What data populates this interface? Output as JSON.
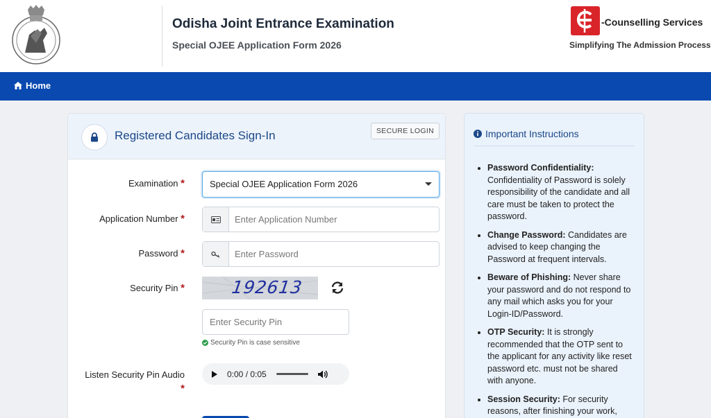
{
  "header": {
    "title": "Odisha Joint Entrance Examination",
    "subtitle": "Special OJEE Application Form 2026",
    "brand_name": "-Counselling Services",
    "brand_tagline": "Simplifying The Admission Process"
  },
  "nav": {
    "home_label": "Home"
  },
  "login": {
    "title": "Registered Candidates Sign-In",
    "secure_badge": "SECURE LOGIN",
    "examination_label": "Examination",
    "examination_value": "Special OJEE Application Form 2026",
    "appno_label": "Application Number",
    "appno_placeholder": "Enter Application Number",
    "password_label": "Password",
    "password_placeholder": "Enter Password",
    "pin_label": "Security Pin",
    "captcha_text": "192613",
    "pin_placeholder": "Enter Security Pin",
    "pin_hint": "Security Pin is case sensitive",
    "audio_label": "Listen Security Pin Audio",
    "audio_time": "0:00 / 0:05",
    "required_mark": "*"
  },
  "instructions": {
    "title": "Important Instructions",
    "items": [
      {
        "heading": "Password Confidentiality:",
        "text": "Confidentiality of Password is solely responsibility of the candidate and all care must be taken to protect the password."
      },
      {
        "heading": "Change Password:",
        "text": "Candidates are advised to keep changing the Password at frequent intervals."
      },
      {
        "heading": "Beware of Phishing:",
        "text": "Never share your password and do not respond to any mail which asks you for your Login-ID/Password."
      },
      {
        "heading": "OTP Security:",
        "text": "It is strongly recommended that the OTP sent to the applicant for any activity like reset password etc. must not be shared with anyone."
      },
      {
        "heading": "Session Security:",
        "text": "For security reasons, after finishing your work,"
      }
    ]
  },
  "colors": {
    "primary": "#0a49b0",
    "accent_red": "#d9252a",
    "required": "#b31b1b"
  }
}
